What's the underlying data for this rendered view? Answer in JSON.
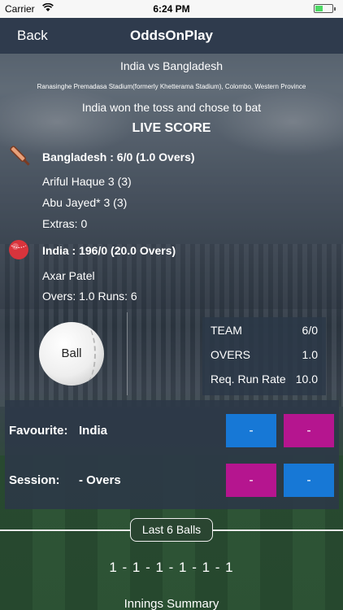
{
  "status_bar": {
    "carrier": "Carrier",
    "time": "6:24 PM",
    "battery_level": 0.45
  },
  "nav": {
    "back_label": "Back",
    "title": "OddsOnPlay"
  },
  "match": {
    "title": "India vs Bangladesh",
    "venue": "Ranasinghe Premadasa Stadium(formerly Khetterama Stadium), Colombo, Western Province",
    "toss": "India won the toss and chose to bat",
    "live_label": "LIVE SCORE"
  },
  "batting": {
    "team_line": "Bangladesh : 6/0 (1.0 Overs)",
    "batsman1": "Ariful Haque 3 (3)",
    "batsman2": "Abu Jayed* 3 (3)",
    "extras": "Extras: 0",
    "icon": "cricket-bat-icon"
  },
  "bowling": {
    "team_line": "India : 196/0 (20.0 Overs)",
    "bowler": "Axar Patel",
    "figures": "Overs: 1.0 Runs: 6",
    "icon": "cricket-ball-icon"
  },
  "ball": {
    "label": "Ball"
  },
  "stats": {
    "team_label": "TEAM",
    "team_value": "6/0",
    "overs_label": "OVERS",
    "overs_value": "1.0",
    "rrr_label": "Req. Run Rate",
    "rrr_value": "10.0"
  },
  "odds": {
    "favourite_label": "Favourite:",
    "favourite_team": "India",
    "session_label": "Session:",
    "session_value": "- Overs",
    "fav_btn1": "-",
    "fav_btn2": "-",
    "sess_btn1": "-",
    "sess_btn2": "-"
  },
  "last_balls": {
    "label": "Last 6 Balls",
    "sequence": "1 - 1 - 1 - 1 - 1 - 1"
  },
  "innings_label": "Innings Summary",
  "colors": {
    "accent_blue": "#1778d6",
    "accent_pink": "#b5158f",
    "nav_bg": "#2f3b4d"
  }
}
